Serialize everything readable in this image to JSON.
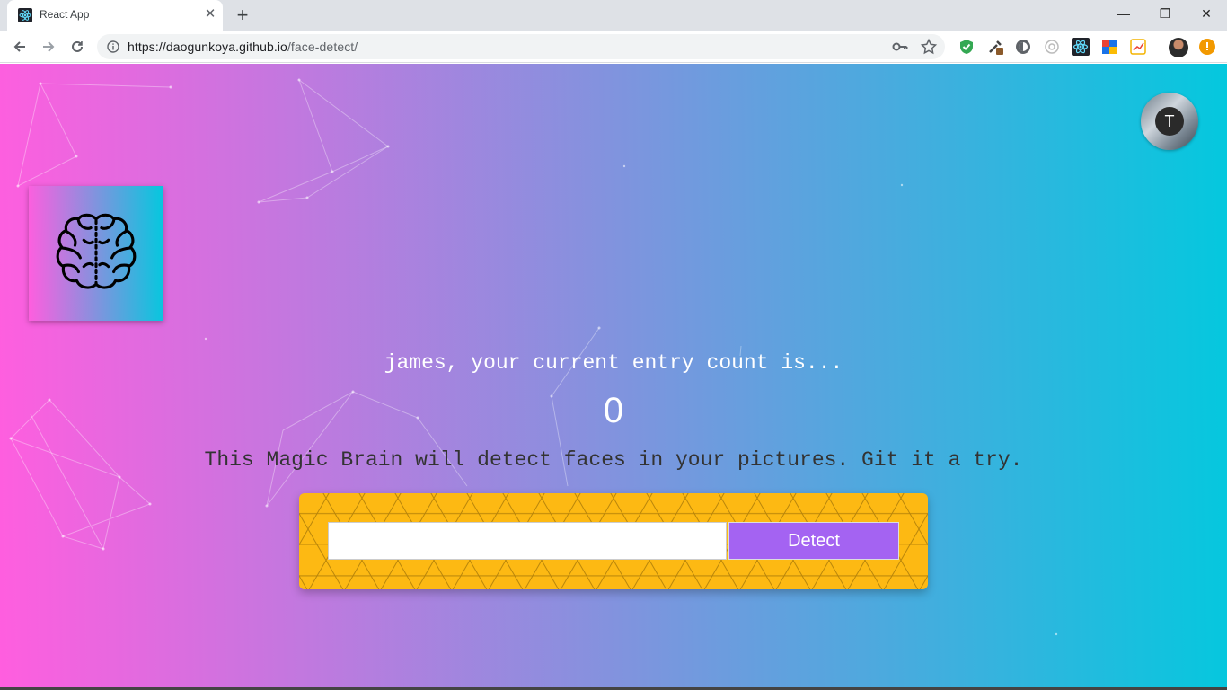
{
  "browser": {
    "tab_title": "React App",
    "tab_close": "✕",
    "new_tab": "+",
    "url_host": "https://daogunkoya.github.io",
    "url_path": "/face-detect/",
    "window_controls": {
      "minimize": "—",
      "restore": "❐",
      "close": "✕"
    }
  },
  "page": {
    "greeting": "james, your current entry count is...",
    "entry_count": "0",
    "tagline": "This Magic Brain will detect faces in your pictures. Git it a try.",
    "image_url_placeholder": "",
    "detect_label": "Detect",
    "profile_initial": "T"
  },
  "colors": {
    "gradient_start": "#ff5edf",
    "gradient_end": "#04c8de",
    "panel": "#fdb913",
    "button": "#a463f2"
  }
}
